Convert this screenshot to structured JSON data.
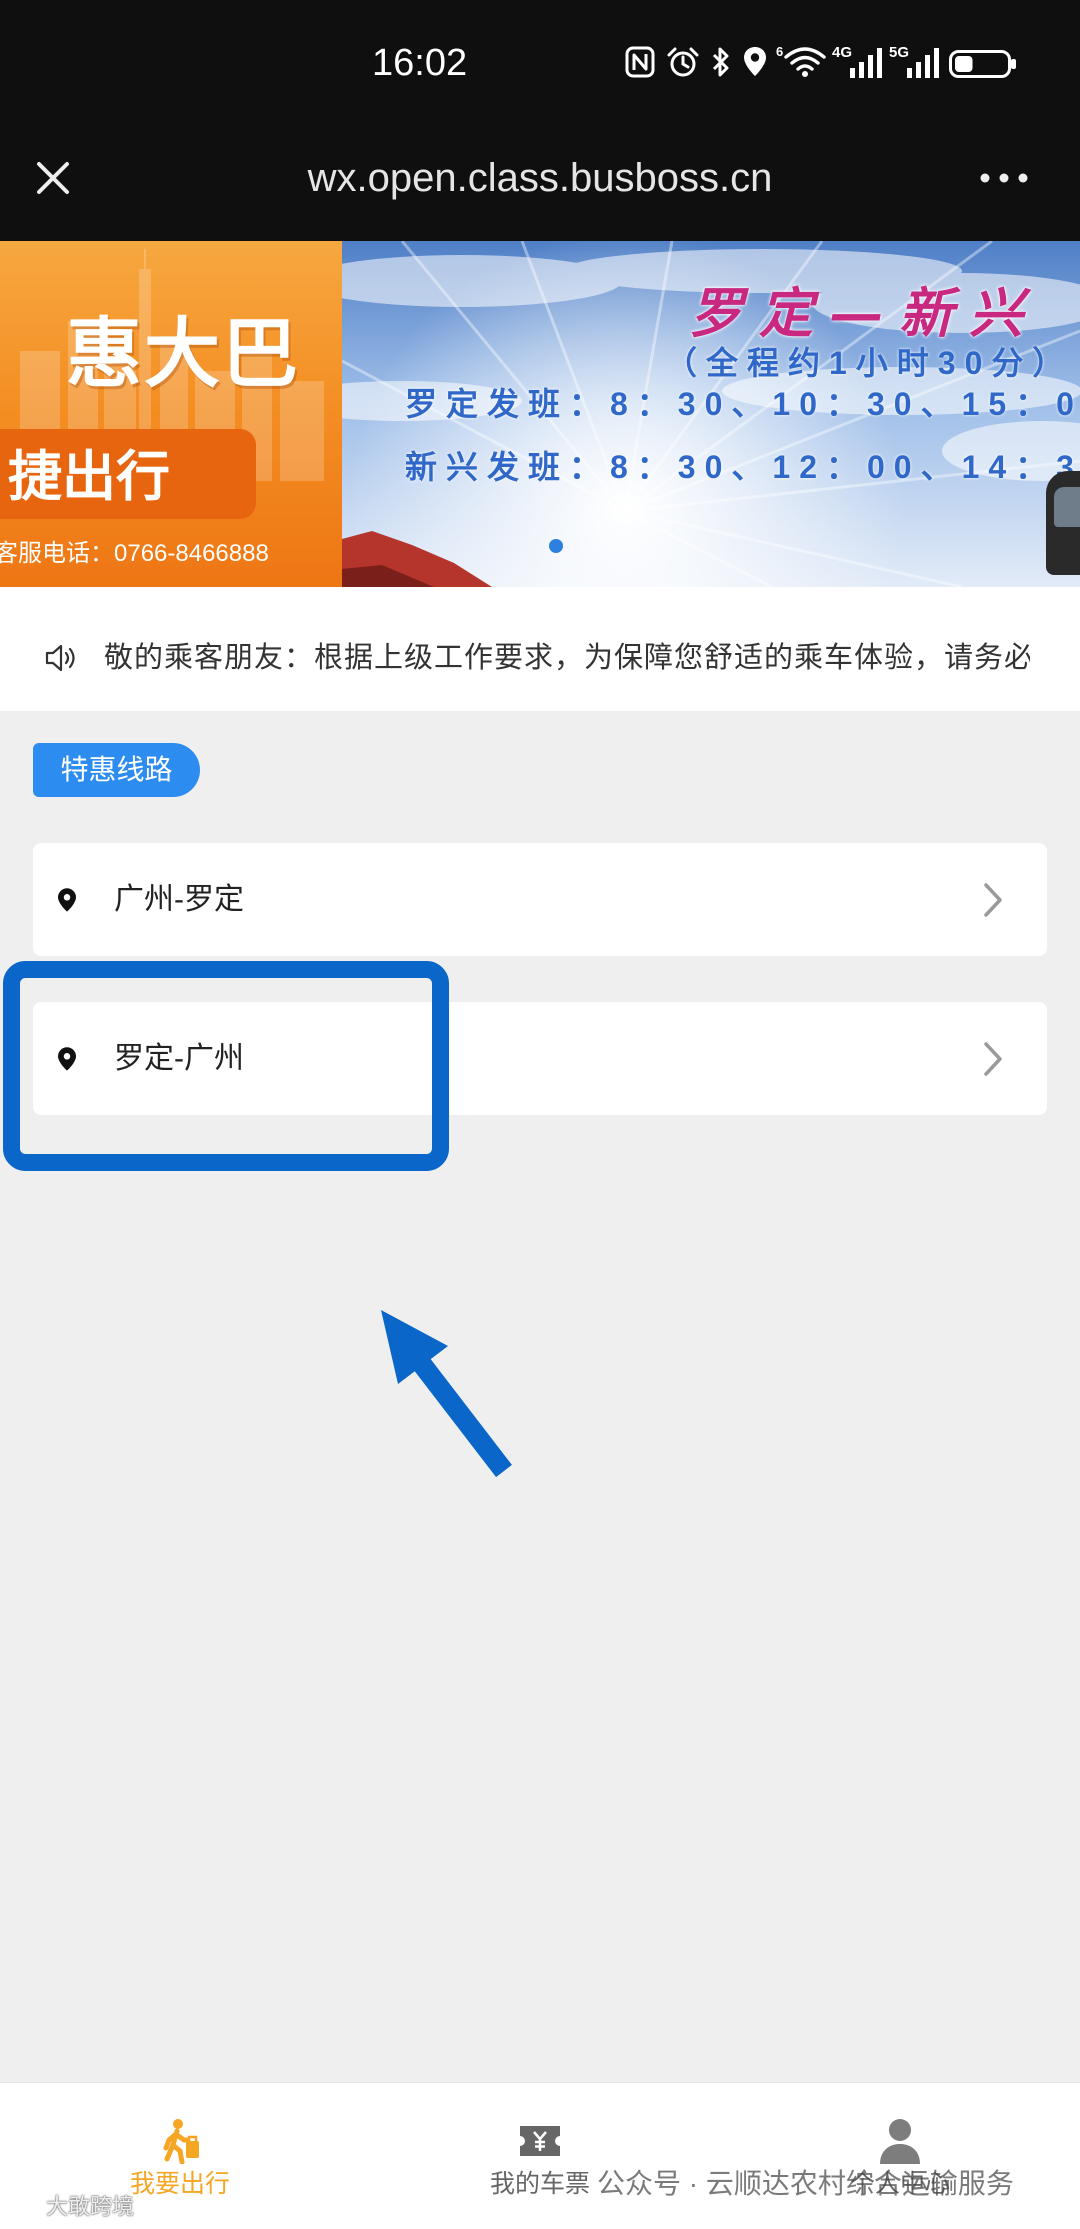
{
  "colors": {
    "accent": "#2d8cf0",
    "active_tab": "#f5a623",
    "inactive_tab": "#666666",
    "annotation": "#0b66c9",
    "banner_orange": "#f38d22",
    "schedule_blue": "#2f68c8",
    "route_title": "#c8287f"
  },
  "status_bar": {
    "time": "16:02",
    "wifi_badge": "6",
    "sim1_label": "4G",
    "sim2_label": "5G",
    "battery_level": 0.35,
    "icons": [
      "nfc-icon",
      "alarm-icon",
      "bluetooth-icon",
      "location-icon",
      "wifi-icon",
      "signal-4g-icon",
      "signal-5g-icon",
      "battery-icon"
    ]
  },
  "browser_bar": {
    "url": "wx.open.class.busboss.cn",
    "close_icon": "close-icon",
    "more_icon": "more-icon"
  },
  "banner": {
    "left": {
      "title": "惠大巴",
      "slogan": "捷出行",
      "hotline": "客服电话：0766-8466888"
    },
    "right": {
      "route": "罗定—新兴",
      "duration": "（全程约1小时30分）",
      "schedule_luoding": "罗定发班：8：30、10：30、15：0",
      "schedule_xinxing": "新兴发班：8：30、12：00、14：3"
    }
  },
  "notice": {
    "icon": "speaker-icon",
    "text": "敬的乘客朋友：根据上级工作要求，为保障您舒适的乘车体验，请务必"
  },
  "section": {
    "badge": "特惠线路"
  },
  "routes": [
    {
      "label": "广州-罗定",
      "icon": "location-pin-icon"
    },
    {
      "label": "罗定-广州",
      "icon": "location-pin-icon"
    }
  ],
  "tab_bar": {
    "items": [
      {
        "label": "我要出行",
        "icon": "traveler-icon",
        "active": true
      },
      {
        "label": "我的车票",
        "icon": "ticket-icon",
        "active": false
      },
      {
        "label": "个人中心",
        "icon": "user-icon",
        "active": false
      }
    ]
  },
  "watermarks": {
    "channel": "公众号 · 云顺达农村综合运输服务",
    "brand": "大敢跨境"
  }
}
